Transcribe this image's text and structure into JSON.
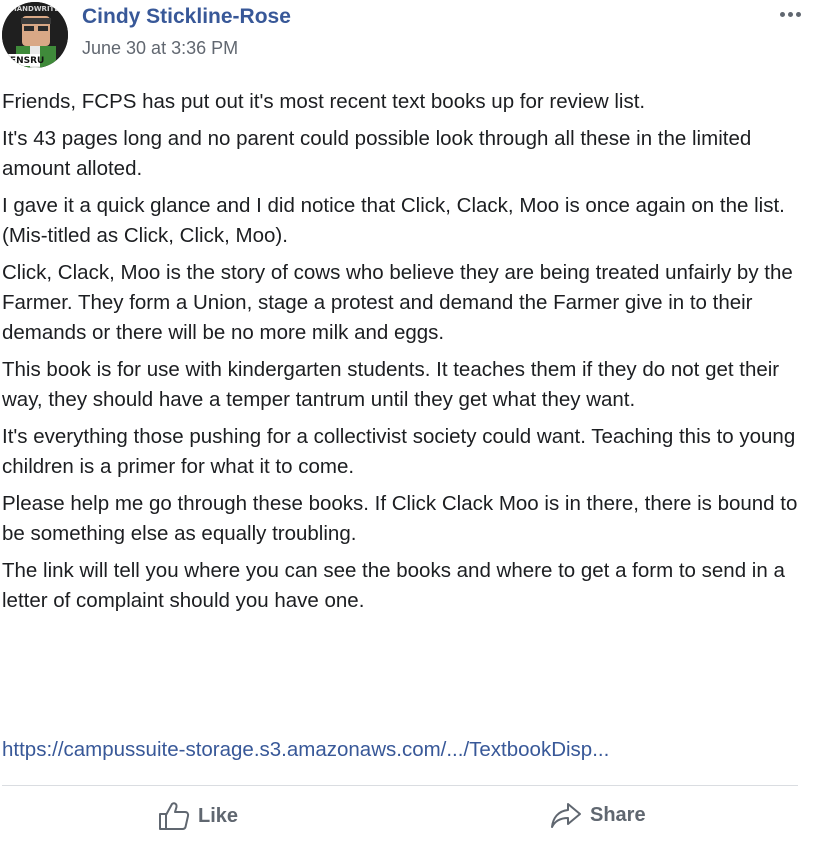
{
  "author": {
    "name": "Cindy Stickline-Rose",
    "avatar_text_top": "HANDWRITE",
    "avatar_text_bottom": "RENSRU"
  },
  "timestamp": "June 30 at 3:36 PM",
  "paragraphs": [
    "Friends, FCPS has put out it's most recent text books up for review list.",
    "It's 43 pages long and no parent could possible look through all these in the limited amount alloted.",
    "I gave it a quick glance and I did notice that Click, Clack, Moo is once again on the list. (Mis-titled as Click, Click, Moo).",
    "Click, Clack, Moo is the story of cows who believe they are being treated unfairly by the Farmer. They form a Union, stage a protest and demand the Farmer give in to their demands or there will be no more milk and eggs.",
    "This book is for use with kindergarten students. It teaches them if they do not get their way, they should have a temper tantrum until they get what they want.",
    "It's everything those pushing for a collectivist society could want. Teaching this to young children is a primer for what it to come.",
    "Please help me go through these books. If Click Clack Moo is in there, there is bound to be something else as equally troubling.",
    "The link will tell you where you can see the books and where to get a form to send in a letter of complaint should you have one."
  ],
  "link": {
    "text": "https://campussuite-storage.s3.amazonaws.com/.../TextbookDisp..."
  },
  "actions": {
    "like_label": "Like",
    "share_label": "Share"
  },
  "icons": {
    "more": "more-horizontal-icon",
    "like": "thumbs-up-icon",
    "share": "share-arrow-icon"
  },
  "colors": {
    "author_link": "#385898",
    "text": "#1c1e21",
    "secondary": "#616770",
    "action": "#606770"
  }
}
